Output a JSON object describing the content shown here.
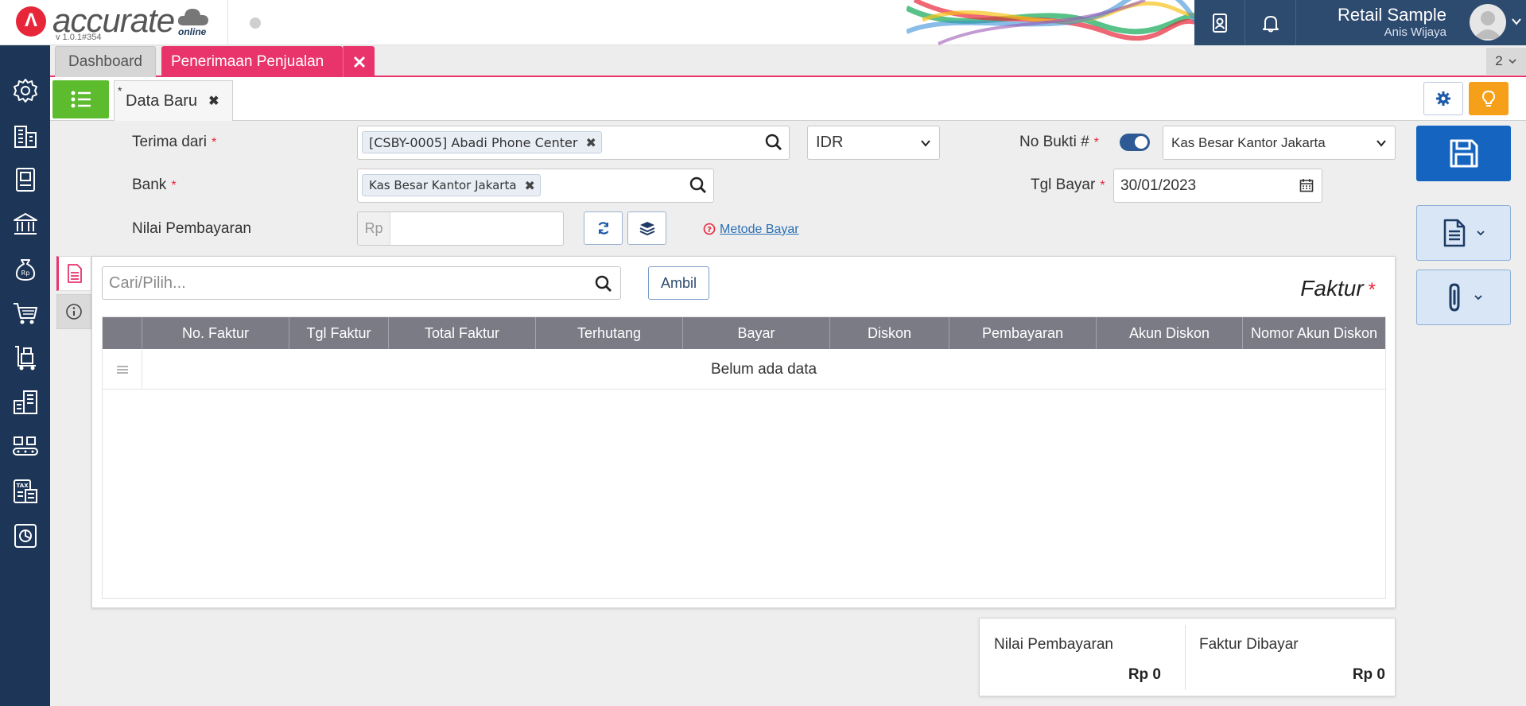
{
  "app": {
    "logo_text": "accurate",
    "logo_sub": "online",
    "version": "v 1.0.1#354"
  },
  "header": {
    "company": "Retail Sample",
    "user": "Anis Wijaya",
    "icons": [
      "contacts-book-icon",
      "bell-icon",
      "avatar-icon",
      "chevron-down-icon"
    ]
  },
  "sidebar": {
    "icons": [
      "gear-icon",
      "building-icon",
      "ledger-book-icon",
      "bank-icon",
      "money-bag-icon",
      "cart-icon",
      "cart-delivery-icon",
      "warehouse-icon",
      "production-icon",
      "tax-report-icon",
      "report-chart-icon"
    ]
  },
  "tabs": {
    "dashboard": "Dashboard",
    "active": "Penerimaan Penjualan",
    "count": "2"
  },
  "subtab": {
    "star": "*",
    "title": "Data Baru"
  },
  "form": {
    "terima_label": "Terima dari",
    "terima_value": "[CSBY-0005] Abadi Phone Center",
    "currency": "IDR",
    "nobukti_label": "No Bukti #",
    "nobukti_value": "Kas Besar Kantor Jakarta",
    "bank_label": "Bank",
    "bank_value": "Kas Besar Kantor Jakarta",
    "tgl_label": "Tgl Bayar",
    "tgl_value": "30/01/2023",
    "nilai_label": "Nilai Pembayaran",
    "nilai_prefix": "Rp",
    "metode_link": "Metode Bayar",
    "required_mark": "*"
  },
  "panel": {
    "search_placeholder": "Cari/Pilih...",
    "ambil": "Ambil",
    "title": "Faktur",
    "required_mark": "*",
    "columns": [
      "No. Faktur",
      "Tgl Faktur",
      "Total Faktur",
      "Terhutang",
      "Bayar",
      "Diskon",
      "Pembayaran",
      "Akun Diskon",
      "Nomor Akun Diskon"
    ],
    "empty": "Belum ada data"
  },
  "summary": {
    "nilai_label": "Nilai Pembayaran",
    "nilai_value": "Rp 0",
    "faktur_label": "Faktur Dibayar",
    "faktur_value": "Rp 0"
  },
  "colors": {
    "accent": "#e8336b",
    "navy": "#1d3557",
    "header_block": "#2d4a6f",
    "save": "#1565c0",
    "list_btn": "#5dbb2e",
    "tips": "#f6a01a"
  }
}
